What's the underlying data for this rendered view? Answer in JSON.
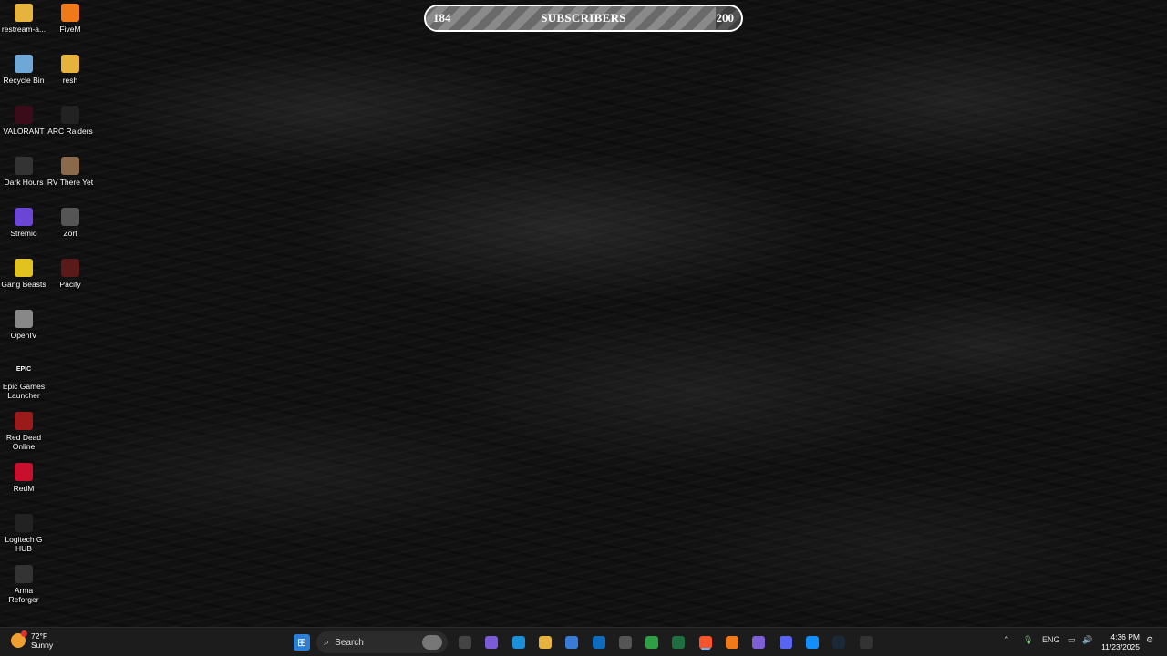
{
  "subscribers": {
    "current": "184",
    "title": "SUBSCRIBERS",
    "goal": "200",
    "progress": 0.92
  },
  "desktop_icons": [
    {
      "label": "restream-a...",
      "icon": "folder-icon",
      "color": "#e6b43c"
    },
    {
      "label": "FiveM",
      "icon": "fivem-icon",
      "color": "#f07a1a"
    },
    {
      "label": "Recycle Bin",
      "icon": "recycle-bin-icon",
      "color": "#6fa8d6"
    },
    {
      "label": "resh",
      "icon": "folder-icon",
      "color": "#e6b43c"
    },
    {
      "label": "VALORANT",
      "icon": "valorant-icon",
      "color": "#3a0b18"
    },
    {
      "label": "ARC Raiders",
      "icon": "arc-raiders-icon",
      "color": "#222"
    },
    {
      "label": "Dark Hours",
      "icon": "dark-hours-icon",
      "color": "#333"
    },
    {
      "label": "RV There Yet",
      "icon": "rv-there-yet-icon",
      "color": "#8a6a4a"
    },
    {
      "label": "Stremio",
      "icon": "stremio-icon",
      "color": "#6b46d6"
    },
    {
      "label": "Zort",
      "icon": "zort-icon",
      "color": "#555"
    },
    {
      "label": "Gang Beasts",
      "icon": "gang-beasts-icon",
      "color": "#e2c21e"
    },
    {
      "label": "Pacify",
      "icon": "pacify-icon",
      "color": "#5a1a1a"
    },
    {
      "label": "OpenIV",
      "icon": "openiv-icon",
      "color": "#888"
    },
    {
      "label": "Epic Games Launcher",
      "icon": "epic-games-icon",
      "color": "#111",
      "glyph": "EPIC"
    },
    {
      "label": "Red Dead Online",
      "icon": "red-dead-online-icon",
      "color": "#9b1b1b"
    },
    {
      "label": "RedM",
      "icon": "redm-icon",
      "color": "#c8102e"
    },
    {
      "label": "Logitech G HUB",
      "icon": "logitech-ghub-icon",
      "color": "#222"
    },
    {
      "label": "Arma Reforger",
      "icon": "arma-reforger-icon",
      "color": "#333"
    }
  ],
  "taskbar": {
    "weather": {
      "temp": "72°F",
      "condition": "Sunny"
    },
    "search_label": "Search",
    "tray": {
      "language": "ENG",
      "time": "4:36 PM",
      "date": "11/23/2025"
    },
    "pinned": [
      {
        "icon": "task-view-icon",
        "color": "#444"
      },
      {
        "icon": "copilot-icon",
        "color": "#7b5cd6"
      },
      {
        "icon": "edge-icon",
        "color": "#1b8fd8"
      },
      {
        "icon": "file-explorer-icon",
        "color": "#e6b43c"
      },
      {
        "icon": "microsoft-store-icon",
        "color": "#3a7bd5"
      },
      {
        "icon": "outlook-icon",
        "color": "#0f6cbd"
      },
      {
        "icon": "app-icon",
        "color": "#555"
      },
      {
        "icon": "chrome-icon",
        "color": "#2f9e44"
      },
      {
        "icon": "excel-icon",
        "color": "#1d6f42"
      },
      {
        "icon": "brave-icon",
        "color": "#fb542b"
      },
      {
        "icon": "fivem-icon",
        "color": "#f07a1a"
      },
      {
        "icon": "app-icon",
        "color": "#7d5fd6"
      },
      {
        "icon": "discord-icon",
        "color": "#5865f2"
      },
      {
        "icon": "battle-net-icon",
        "color": "#148eff"
      },
      {
        "icon": "steam-icon",
        "color": "#1b2838"
      },
      {
        "icon": "obs-icon",
        "color": "#333"
      }
    ]
  }
}
